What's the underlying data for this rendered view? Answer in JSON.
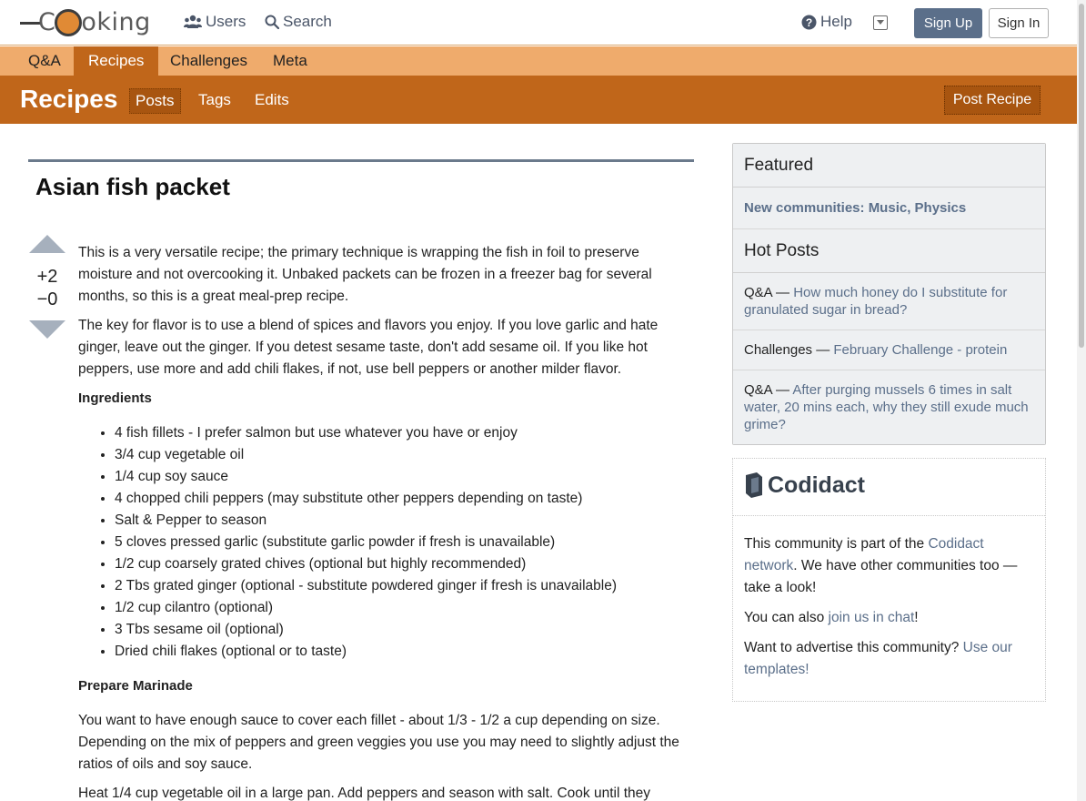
{
  "site": {
    "logo_text": "Cooking"
  },
  "topnav": {
    "users_label": "Users",
    "search_label": "Search",
    "help_label": "Help",
    "signup_label": "Sign Up",
    "signin_label": "Sign In"
  },
  "category_tabs": [
    "Q&A",
    "Recipes",
    "Challenges",
    "Meta"
  ],
  "active_category": "Recipes",
  "section_header": {
    "title": "Recipes",
    "links": [
      "Posts",
      "Tags",
      "Edits"
    ],
    "post_button": "Post Recipe"
  },
  "post": {
    "title": "Asian fish packet",
    "votes": {
      "up": "+2",
      "down": "−0"
    },
    "paragraphs": [
      "This is a very versatile recipe; the primary technique is wrapping the fish in foil to preserve moisture and not overcooking it. Unbaked packets can be frozen in a freezer bag for several months, so this is a great meal-prep recipe.",
      "The key for flavor is to use a blend of spices and flavors you enjoy. If you love garlic and hate ginger, leave out the ginger. If you detest sesame taste, don't add sesame oil. If you like hot peppers, use more and add chili flakes, if not, use bell peppers or another milder flavor."
    ],
    "ingredients_heading": "Ingredients",
    "ingredients": [
      "4 fish fillets - I prefer salmon but use whatever you have or enjoy",
      "3/4 cup vegetable oil",
      "1/4 cup soy sauce",
      "4 chopped chili peppers (may substitute other peppers depending on taste)",
      "Salt & Pepper to season",
      "5 cloves pressed garlic (substitute garlic powder if fresh is unavailable)",
      "1/2 cup coarsely grated chives (optional but highly recommended)",
      "2 Tbs grated ginger (optional - substitute powdered ginger if fresh is unavailable)",
      "1/2 cup cilantro (optional)",
      "3 Tbs sesame oil (optional)",
      "Dried chili flakes (optional or to taste)"
    ],
    "marinade_heading": "Prepare Marinade",
    "marinade_paragraphs": [
      "You want to have enough sauce to cover each fillet - about 1/3 - 1/2 a cup depending on size. Depending on the mix of peppers and green veggies you use you may need to slightly adjust the ratios of oils and soy sauce.",
      "Heat 1/4 cup vegetable oil in a large pan. Add peppers and season with salt. Cook until they"
    ]
  },
  "sidebar": {
    "featured_heading": "Featured",
    "featured_item": "New communities: Music, Physics",
    "hot_heading": "Hot Posts",
    "hot_posts": [
      {
        "category": "Q&A — ",
        "title": "How much honey do I substitute for granulated sugar in bread?"
      },
      {
        "category": "Challenges — ",
        "title": "February Challenge - protein"
      },
      {
        "category": "Q&A — ",
        "title": "After purging mussels 6 times in salt water, 20 mins each, why they still exude much grime?"
      }
    ]
  },
  "codidact": {
    "logo_text": "Codidact",
    "p1_a": "This community is part of the ",
    "p1_link": "Codidact network",
    "p1_b": ". We have other communities too — take a look!",
    "p2_a": "You can also ",
    "p2_link": "join us in chat",
    "p2_b": "!",
    "p3_a": "Want to advertise this community? ",
    "p3_link": "Use our templates!"
  },
  "colors": {
    "accent": "#c0661a",
    "tabbar": "#efab6c",
    "link": "#5b6f8a"
  }
}
